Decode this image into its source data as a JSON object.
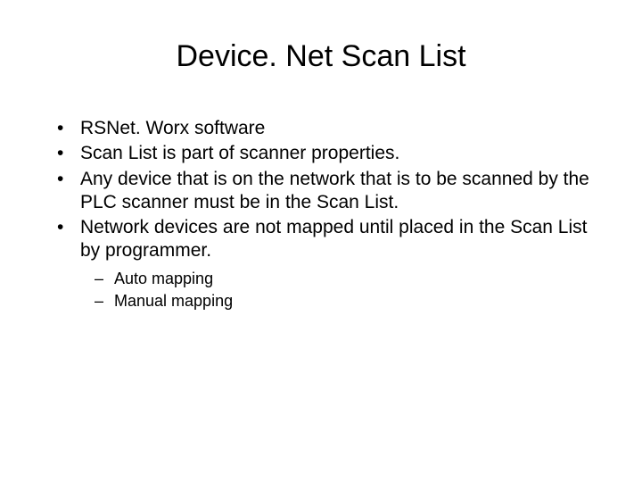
{
  "title": "Device. Net Scan List",
  "bullets": [
    "RSNet. Worx software",
    "Scan List is part of scanner properties.",
    "Any device that is on the network that is to be scanned by the PLC scanner must be in the Scan List.",
    "Network devices are not mapped until placed in the Scan List by programmer."
  ],
  "sub_bullets": [
    "Auto mapping",
    "Manual mapping"
  ]
}
